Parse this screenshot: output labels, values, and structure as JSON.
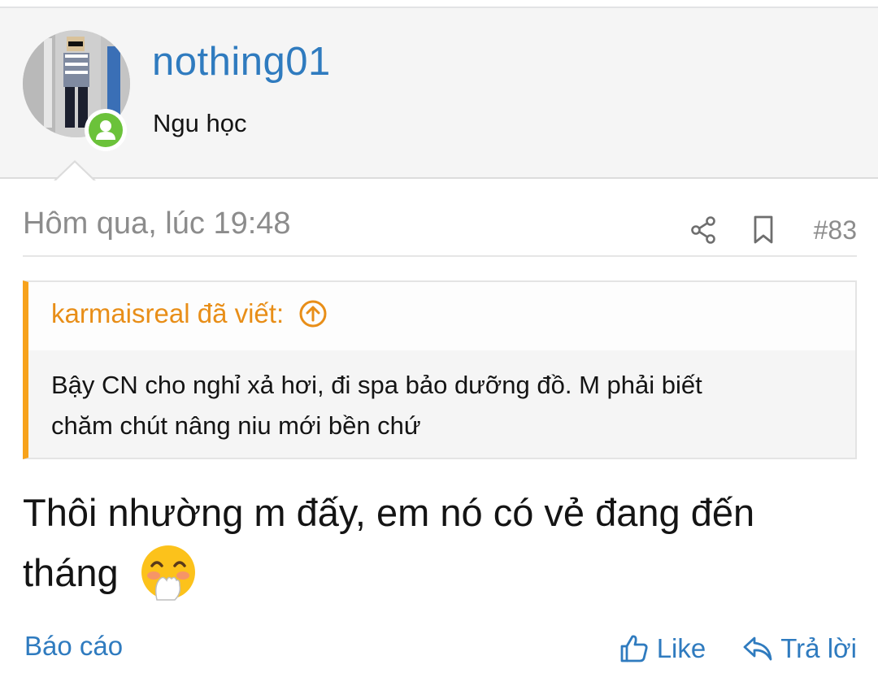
{
  "user": {
    "username": "nothing01",
    "title": "Ngu học",
    "avatar_icon": "avatar-photo",
    "online_color": "#6bc23a"
  },
  "post": {
    "date": "Hôm qua, lúc 19:48",
    "number": "#83",
    "message_line1": "Thôi nhường m đấy, em nó có vẻ đang đến",
    "message_line2": "tháng",
    "emoji": "hand-over-mouth-emoji"
  },
  "quote": {
    "author_label": "karmaisreal đã viết:",
    "text_line1": "Bậy CN cho nghỉ xả hơi, đi spa bảo dưỡng đồ. M phải biết",
    "text_line2": "chăm chút nâng niu mới bền chứ",
    "accent_color": "#f7a21b"
  },
  "footer": {
    "report": "Báo cáo",
    "like": "Like",
    "reply": "Trả lời"
  },
  "colors": {
    "link": "#2f7bbf",
    "meta": "#8c8c8c",
    "text": "#141414"
  }
}
